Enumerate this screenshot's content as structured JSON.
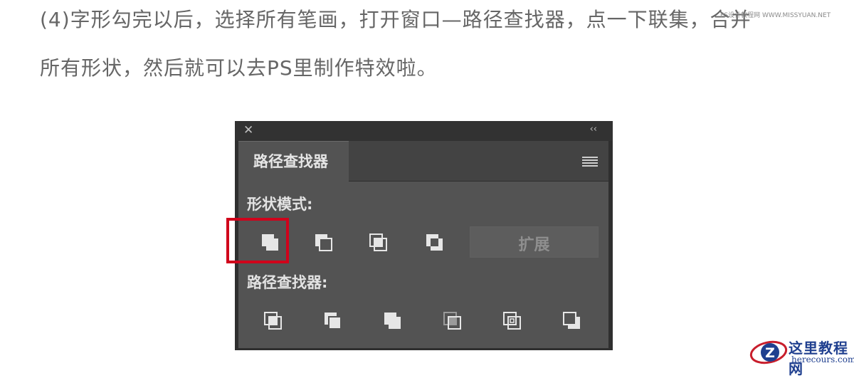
{
  "article": {
    "line1": "(4)字形勾完以后，选择所有笔画，打开窗口—路径查找器，点一下联集，合并",
    "line2": "所有形状，然后就可以去PS里制作特效啦。"
  },
  "watermark_top": "PS设计教程网 WWW.MISSYUAN.NET",
  "panel": {
    "close_glyph": "✕",
    "collapse_glyph": "‹‹",
    "tab_title": "路径查找器",
    "shape_modes_label": "形状模式:",
    "pathfinders_label": "路径查找器:",
    "expand_label": "扩展",
    "shape_mode_icons": [
      "unite-icon",
      "minus-front-icon",
      "intersect-icon",
      "exclude-icon"
    ],
    "pathfinder_icons": [
      "divide-icon",
      "trim-icon",
      "merge-icon",
      "crop-icon",
      "outline-icon",
      "minus-back-icon"
    ],
    "highlighted_button": "unite-icon"
  },
  "colors": {
    "panel_bg": "#535353",
    "highlight": "#d0021b",
    "text": "#666666"
  },
  "watermark_bottom": {
    "logo_icon": "z-logo-icon",
    "title": "这里教程网",
    "url": "herecours.com"
  }
}
